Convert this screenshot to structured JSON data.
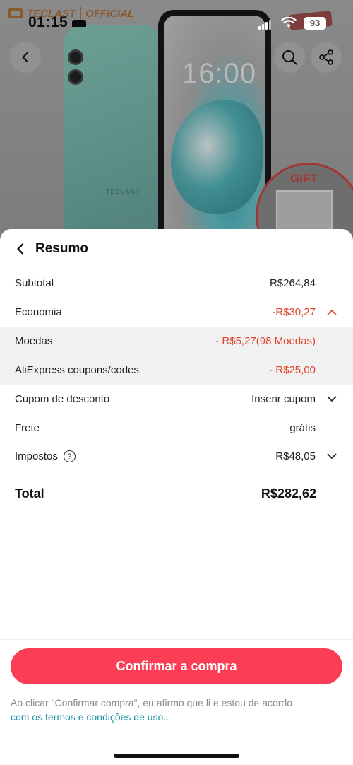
{
  "status_bar": {
    "time": "01:15",
    "battery": "93"
  },
  "backdrop": {
    "brand_logo": "TECLAST",
    "brand_official": "OFFICIAL",
    "phone_clock": "16:00",
    "phone_brand": "TECLAST",
    "gift_label": "GIFT"
  },
  "sheet": {
    "title": "Resumo",
    "rows": {
      "subtotal": {
        "label": "Subtotal",
        "value": "R$264,84"
      },
      "economia": {
        "label": "Economia",
        "value": "-R$30,27"
      },
      "moedas": {
        "label": "Moedas",
        "value": "- R$5,27(98 Moedas)"
      },
      "coupons": {
        "label": "AliExpress coupons/codes",
        "value": "- R$25,00"
      },
      "cupom": {
        "label": "Cupom de desconto",
        "value": "Inserir cupom"
      },
      "frete": {
        "label": "Frete",
        "value": "grátis"
      },
      "impostos": {
        "label": "Impostos",
        "value": "R$48,05",
        "help": "?"
      }
    },
    "total": {
      "label": "Total",
      "value": "R$282,62"
    },
    "confirm_button": "Confirmar a compra",
    "legal_text": "Ao clicar \"Confirmar compra\", eu afirmo que li e estou de acordo",
    "legal_link": "com os termos e condições de uso.."
  },
  "colors": {
    "accent": "#fb3d55",
    "discount": "#e0452b",
    "link": "#1f93a7"
  },
  "icons": [
    "back-arrow-icon",
    "search-icon",
    "share-icon",
    "chevron-up-icon",
    "chevron-down-icon",
    "help-icon",
    "signal-icon",
    "wifi-icon",
    "battery-icon"
  ]
}
